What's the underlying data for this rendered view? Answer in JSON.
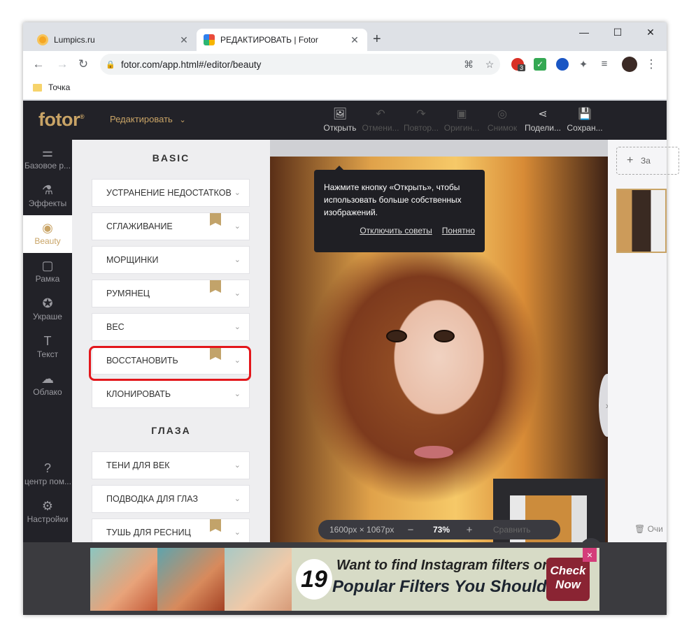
{
  "browser": {
    "tabs": [
      {
        "title": "Lumpics.ru",
        "icon": "lumpics-favicon"
      },
      {
        "title": "РЕДАКТИРОВАТЬ | Fotor",
        "icon": "fotor-favicon"
      }
    ],
    "url": "fotor.com/app.html#/editor/beauty",
    "extension_badge": "3",
    "bookmark": "Точка"
  },
  "app": {
    "logo": "fotor",
    "mode_label": "Редактировать",
    "toolbar": [
      {
        "label": "Открыть",
        "icon": "open-image-icon",
        "enabled": true
      },
      {
        "label": "Отмени...",
        "icon": "undo-icon",
        "enabled": false
      },
      {
        "label": "Повтор...",
        "icon": "redo-icon",
        "enabled": false
      },
      {
        "label": "Оригин...",
        "icon": "original-icon",
        "enabled": false
      },
      {
        "label": "Снимок",
        "icon": "snapshot-icon",
        "enabled": false
      },
      {
        "label": "Подели...",
        "icon": "share-icon",
        "enabled": true
      },
      {
        "label": "Сохран...",
        "icon": "save-icon",
        "enabled": true
      }
    ],
    "leftnav": [
      {
        "label": "Базовое р...",
        "icon": "sliders-icon"
      },
      {
        "label": "Эффекты",
        "icon": "flask-icon"
      },
      {
        "label": "Beauty",
        "icon": "eye-icon",
        "active": true
      },
      {
        "label": "Рамка",
        "icon": "frame-icon"
      },
      {
        "label": "Украше",
        "icon": "star-badge-icon"
      },
      {
        "label": "Текст",
        "icon": "text-icon"
      },
      {
        "label": "Облако",
        "icon": "cloud-icon"
      },
      {
        "label": "центр пом...",
        "icon": "help-icon"
      },
      {
        "label": "Настройки",
        "icon": "settings-icon"
      }
    ],
    "panel": {
      "section_basic": "BASIC",
      "basic_items": [
        {
          "label": "УСТРАНЕНИЕ НЕДОСТАТКОВ",
          "premium": false
        },
        {
          "label": "СГЛАЖИВАНИЕ",
          "premium": true
        },
        {
          "label": "МОРЩИНКИ",
          "premium": false
        },
        {
          "label": "РУМЯНЕЦ",
          "premium": true
        },
        {
          "label": "ВЕС",
          "premium": false
        },
        {
          "label": "ВОССТАНОВИТЬ",
          "premium": true,
          "highlighted": true
        },
        {
          "label": "КЛОНИРОВАТЬ",
          "premium": false
        }
      ],
      "section_eyes": "ГЛАЗА",
      "eye_items": [
        {
          "label": "ТЕНИ ДЛЯ ВЕК",
          "premium": false
        },
        {
          "label": "ПОДВОДКА ДЛЯ ГЛАЗ",
          "premium": false
        },
        {
          "label": "ТУШЬ ДЛЯ РЕСНИЦ",
          "premium": true
        }
      ]
    },
    "tooltip": {
      "text": "Нажмите кнопку «Открыть», чтобы использовать больше собственных изображений.",
      "disable_link": "Отключить советы",
      "ok_link": "Понятно"
    },
    "zoom": {
      "dimensions": "1600px × 1067px",
      "minus": "−",
      "value": "73%",
      "plus": "+",
      "compare": "Сравнить"
    },
    "rightpanel": {
      "add_label": "За",
      "clear_label": "Очи"
    },
    "ad": {
      "number": "19",
      "line1": "Want to find Instagram filters online?",
      "line2": "Popular Filters You Should Try",
      "cta": "Check Now",
      "close": "×"
    },
    "colors": {
      "accent": "#c9a466",
      "highlight": "#e3161b",
      "dark_bg": "#222228"
    }
  }
}
